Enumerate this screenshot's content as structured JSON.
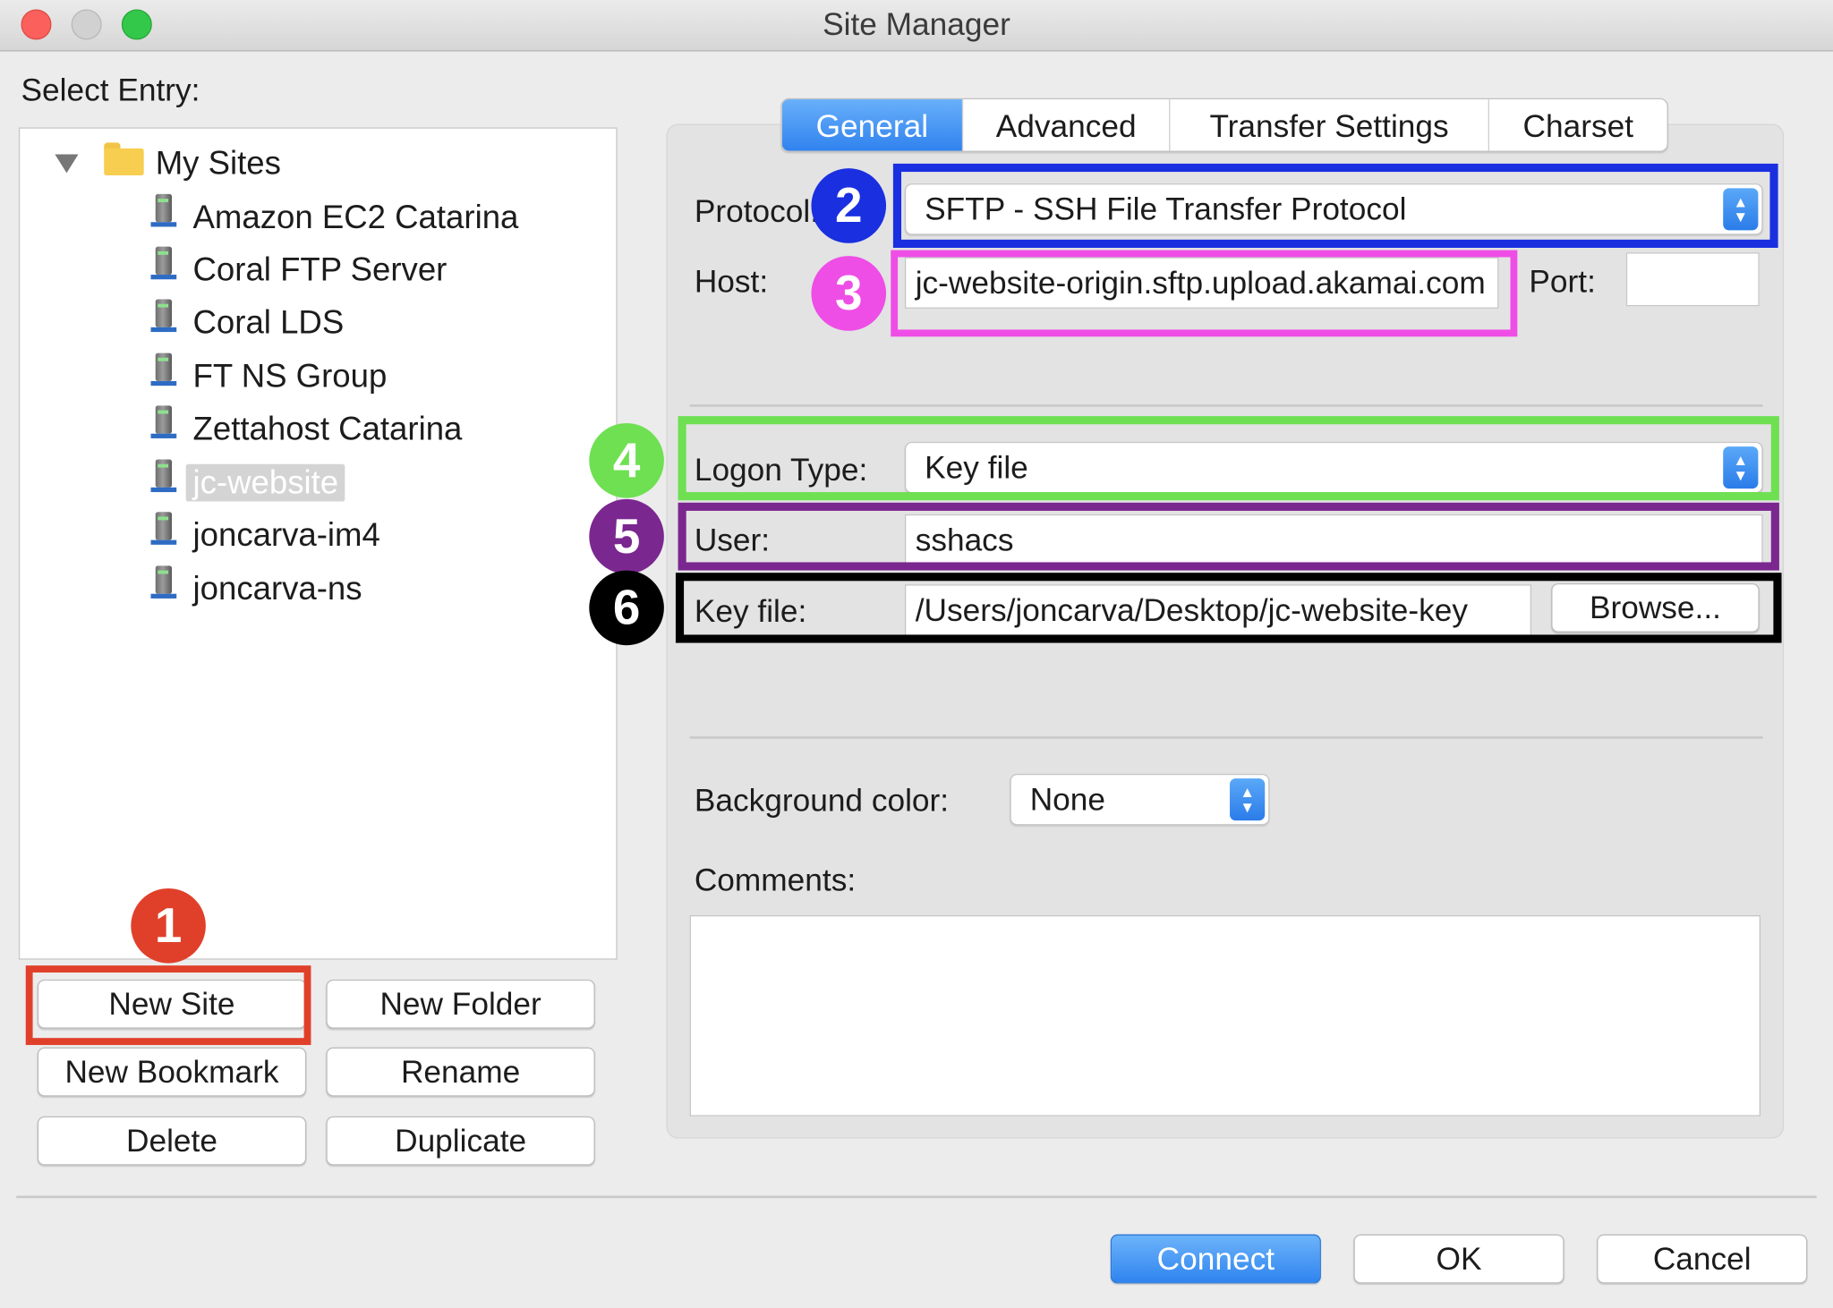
{
  "window": {
    "title": "Site Manager"
  },
  "select_entry_label": "Select Entry:",
  "tree": {
    "root_label": "My Sites",
    "items": [
      {
        "label": "Amazon EC2 Catarina"
      },
      {
        "label": "Coral FTP Server"
      },
      {
        "label": "Coral LDS"
      },
      {
        "label": "FT NS Group"
      },
      {
        "label": "Zettahost Catarina"
      },
      {
        "label": "jc-website",
        "selected": true
      },
      {
        "label": "joncarva-im4"
      },
      {
        "label": "joncarva-ns"
      }
    ]
  },
  "left_buttons": {
    "new_site": "New Site",
    "new_folder": "New Folder",
    "new_bookmark": "New Bookmark",
    "rename": "Rename",
    "delete": "Delete",
    "duplicate": "Duplicate"
  },
  "tabs": [
    {
      "label": "General",
      "active": true
    },
    {
      "label": "Advanced"
    },
    {
      "label": "Transfer Settings"
    },
    {
      "label": "Charset"
    }
  ],
  "general": {
    "protocol_label": "Protocol:",
    "protocol_value": "SFTP - SSH File Transfer Protocol",
    "host_label": "Host:",
    "host_value": "jc-website-origin.sftp.upload.akamai.com",
    "port_label": "Port:",
    "port_value": "",
    "logon_type_label": "Logon Type:",
    "logon_type_value": "Key file",
    "user_label": "User:",
    "user_value": "sshacs",
    "key_file_label": "Key file:",
    "key_file_value": "/Users/joncarva/Desktop/jc-website-key",
    "browse_label": "Browse...",
    "background_color_label": "Background color:",
    "background_color_value": "None",
    "comments_label": "Comments:",
    "comments_value": ""
  },
  "footer": {
    "connect": "Connect",
    "ok": "OK",
    "cancel": "Cancel"
  },
  "annotations": [
    {
      "number": "1",
      "color": "#e0402a"
    },
    {
      "number": "2",
      "color": "#1a2fe0"
    },
    {
      "number": "3",
      "color": "#ee4ee6"
    },
    {
      "number": "4",
      "color": "#6ee052"
    },
    {
      "number": "5",
      "color": "#7b2790"
    },
    {
      "number": "6",
      "color": "#000000"
    }
  ]
}
